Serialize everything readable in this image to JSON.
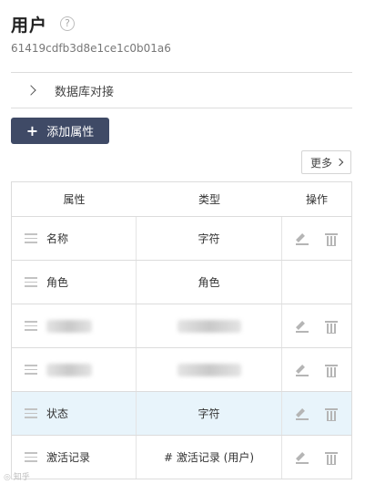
{
  "header": {
    "title": "用户",
    "help_icon": "?",
    "entity_id": "61419cdfb3d8e1ce1c0b01a6"
  },
  "collapse": {
    "label": "数据库对接",
    "icon": "chevron-right-icon"
  },
  "actions": {
    "add_label": "添加属性",
    "add_icon": "+",
    "more_label": "更多"
  },
  "table": {
    "columns": [
      "属性",
      "类型",
      "操作"
    ],
    "rows": [
      {
        "name": "名称",
        "type": "字符",
        "editable": true,
        "highlight": false
      },
      {
        "name": "角色",
        "type": "角色",
        "editable": false,
        "highlight": false
      },
      {
        "name": "",
        "type": "",
        "editable": true,
        "highlight": false,
        "obscured": true
      },
      {
        "name": "",
        "type": "",
        "editable": true,
        "highlight": false,
        "obscured": true
      },
      {
        "name": "状态",
        "type": "字符",
        "editable": true,
        "highlight": true
      },
      {
        "name": "激活记录",
        "type": "# 激活记录 (用户)",
        "editable": true,
        "highlight": false
      }
    ]
  },
  "colors": {
    "primary_button": "#3f4a66",
    "row_highlight": "#e8f4fb"
  }
}
